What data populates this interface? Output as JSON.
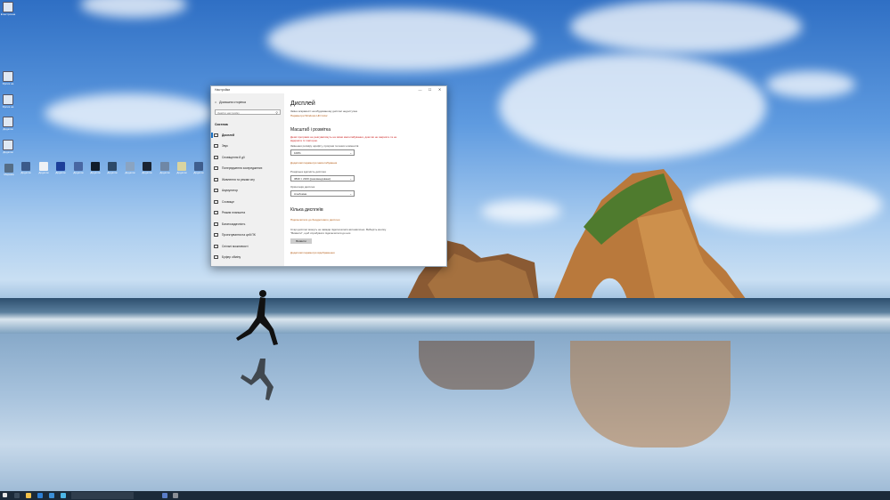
{
  "desktop": {
    "icons_left": [
      {
        "label": "Електронна"
      },
      {
        "label": "Ярлик на"
      },
      {
        "label": "Ярлик на"
      },
      {
        "label": "Додаток"
      },
      {
        "label": "Додаток"
      }
    ],
    "icons_row": [
      {
        "label": "Мережа"
      },
      {
        "label": "Додаток"
      },
      {
        "label": "Додаток"
      },
      {
        "label": "Додаток"
      },
      {
        "label": "Додаток"
      },
      {
        "label": "Додаток"
      },
      {
        "label": "Додаток"
      },
      {
        "label": "Додаток"
      },
      {
        "label": "Додаток"
      },
      {
        "label": "Додаток"
      },
      {
        "label": "Додаток"
      },
      {
        "label": "Додаток"
      }
    ]
  },
  "window": {
    "title": "Настройки",
    "min": "—",
    "max": "☐",
    "close": "✕"
  },
  "sidebar": {
    "home": "Домашня сторінка",
    "search_placeholder": "Знайти настройку",
    "section": "Система",
    "items": [
      {
        "label": "Дисплей"
      },
      {
        "label": "Звук"
      },
      {
        "label": "Сповіщення й дії"
      },
      {
        "label": "Попередження зосереджених"
      },
      {
        "label": "Живлення та режим сну"
      },
      {
        "label": "Акумулятор"
      },
      {
        "label": "Сховище"
      },
      {
        "label": "Режим планшета"
      },
      {
        "label": "Багатозадачність"
      },
      {
        "label": "Проектування на цей ПК"
      },
      {
        "label": "Спільні можливості"
      },
      {
        "label": "Буфер обміну"
      }
    ]
  },
  "content": {
    "title": "Дисплей",
    "brightness_note": "Зміна яскравості на вбудованому дисплеї недоступна",
    "night_light": "Параметри Windows HD Color",
    "scale_heading": "Масштаб і розмітка",
    "scale_warning": "Деякі програми не реагуватимуть на зміни масштабування, доки ви не закриєте та не відкриєте їх повторно.",
    "scale_label": "Змінення розміру шрифту, програм та інших елементів",
    "scale_value": "100%",
    "advanced_scale": "Додаткові параметри масштабування",
    "resolution_label": "Роздільна здатність дисплея",
    "resolution_value": "3840 × 2160 (рекомендовано)",
    "orientation_label": "Орієнтація дисплея",
    "orientation_value": "Альбомна",
    "multi_heading": "Кілька дисплеїв",
    "wireless_link": "Підключитися до бездротового дисплея",
    "detect_note": "Старі дисплеї можуть не завжди підключатися автоматично. Виберіть кнопку \"Виявити\", щоб спробувати підключитися до них.",
    "detect_button": "Виявити",
    "advanced_display": "Додаткові параметри відображення"
  },
  "taskbar": {
    "search_text": "",
    "clock_time": "",
    "clock_date": ""
  }
}
